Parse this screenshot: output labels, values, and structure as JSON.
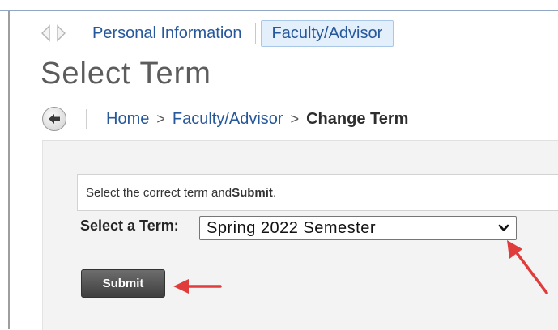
{
  "tabs": {
    "personal_label": "Personal Information",
    "faculty_label": "Faculty/Advisor"
  },
  "page": {
    "title": "Select Term"
  },
  "breadcrumb": {
    "home": "Home",
    "faculty": "Faculty/Advisor",
    "current": "Change Term",
    "separator": ">"
  },
  "form": {
    "instruction_prefix": "Select the correct term and ",
    "instruction_bold": "Submit",
    "instruction_suffix": ".",
    "term_label": "Select a Term:",
    "term_selected": "Spring 2022 Semester",
    "submit_label": "Submit"
  },
  "colors": {
    "link": "#26589b",
    "annotation_arrow": "#e03c3c",
    "tab_active_bg": "#e3effa"
  },
  "icons": {
    "nav_left": "triangle-left-icon",
    "nav_right": "triangle-right-icon",
    "back": "back-arrow-icon",
    "select_caret": "chevron-down-icon"
  }
}
